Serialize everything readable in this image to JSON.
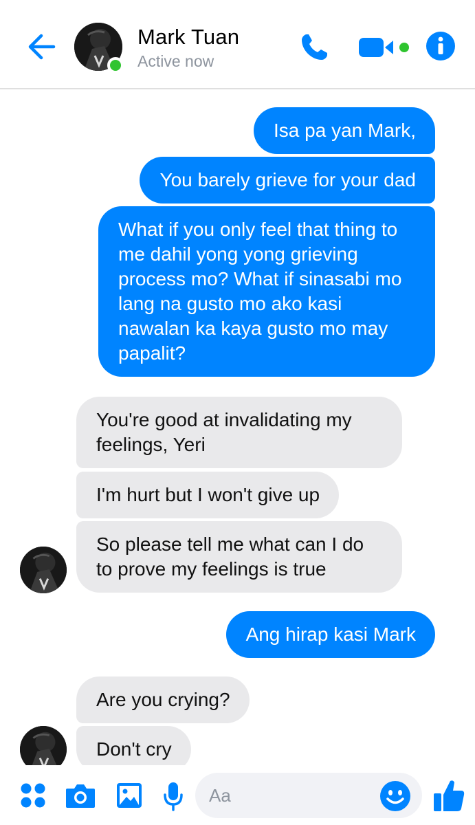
{
  "colors": {
    "accent": "#0084ff",
    "incoming_bubble": "#e9e9eb",
    "active_dot": "#2fc42f",
    "status_text": "#8d949e"
  },
  "header": {
    "contact_name": "Mark Tuan",
    "status": "Active now",
    "icons": [
      "back-arrow-icon",
      "phone-icon",
      "video-camera-icon",
      "info-icon"
    ]
  },
  "messages": [
    {
      "direction": "outgoing",
      "text": "Isa pa yan Mark,"
    },
    {
      "direction": "outgoing",
      "text": "You barely grieve for your dad"
    },
    {
      "direction": "outgoing",
      "text": "What if you only feel that thing to me dahil yong yong grieving process mo? What if sinasabi mo lang na gusto mo ako kasi nawalan ka kaya gusto mo may papalit?"
    },
    {
      "direction": "incoming",
      "text": "You're good at invalidating my feelings, Yeri"
    },
    {
      "direction": "incoming",
      "text": "I'm hurt but I won't give up"
    },
    {
      "direction": "incoming",
      "text": "So please tell me what can I do to prove my feelings is true"
    },
    {
      "direction": "outgoing",
      "text": "Ang hirap kasi Mark"
    },
    {
      "direction": "incoming",
      "text": "Are you crying?"
    },
    {
      "direction": "incoming",
      "text": "Don't cry"
    }
  ],
  "composer": {
    "placeholder": "Aa",
    "icons": [
      "apps-icon",
      "camera-icon",
      "gallery-icon",
      "microphone-icon",
      "emoji-icon",
      "thumbs-up-icon"
    ]
  }
}
